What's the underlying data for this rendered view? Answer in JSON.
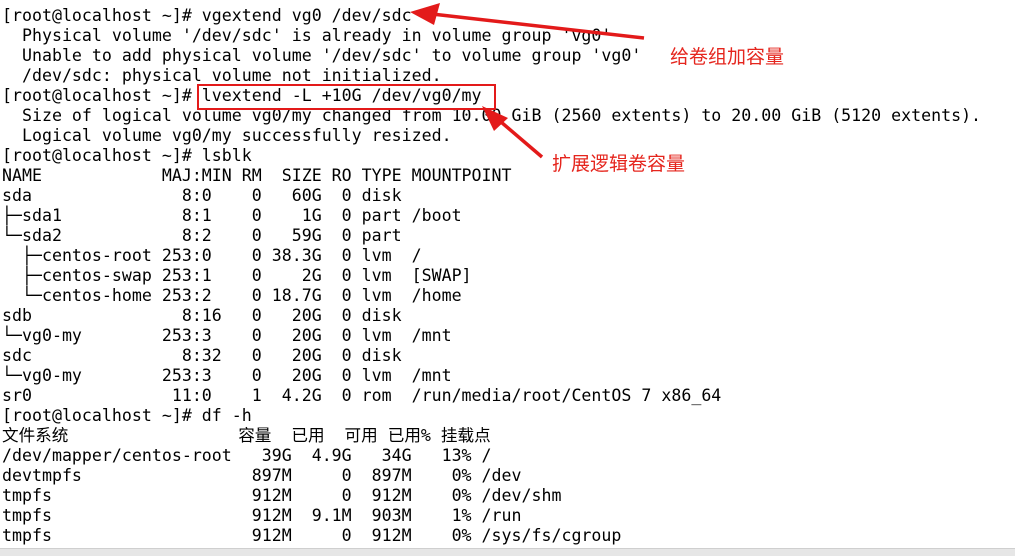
{
  "terminal": {
    "lines": [
      "[root@localhost ~]# vgextend vg0 /dev/sdc",
      "  Physical volume '/dev/sdc' is already in volume group 'vg0'",
      "  Unable to add physical volume '/dev/sdc' to volume group 'vg0'",
      "  /dev/sdc: physical volume not initialized.",
      "[root@localhost ~]# lvextend -L +10G /dev/vg0/my",
      "  Size of logical volume vg0/my changed from 10.00 GiB (2560 extents) to 20.00 GiB (5120 extents).",
      "  Logical volume vg0/my successfully resized.",
      "[root@localhost ~]# lsblk",
      "NAME            MAJ:MIN RM  SIZE RO TYPE MOUNTPOINT",
      "sda               8:0    0   60G  0 disk",
      "├─sda1            8:1    0    1G  0 part /boot",
      "└─sda2            8:2    0   59G  0 part",
      "  ├─centos-root 253:0    0 38.3G  0 lvm  /",
      "  ├─centos-swap 253:1    0    2G  0 lvm  [SWAP]",
      "  └─centos-home 253:2    0 18.7G  0 lvm  /home",
      "sdb               8:16   0   20G  0 disk",
      "└─vg0-my        253:3    0   20G  0 lvm  /mnt",
      "sdc               8:32   0   20G  0 disk",
      "└─vg0-my        253:3    0   20G  0 lvm  /mnt",
      "sr0              11:0    1  4.2G  0 rom  /run/media/root/CentOS 7 x86_64",
      "[root@localhost ~]# df -h",
      "文件系统                 容量  已用  可用 已用% 挂载点",
      "/dev/mapper/centos-root   39G  4.9G   34G   13% /",
      "devtmpfs                 897M     0  897M    0% /dev",
      "tmpfs                    912M     0  912M    0% /dev/shm",
      "tmpfs                    912M  9.1M  903M    1% /run",
      "tmpfs                    912M     0  912M    0% /sys/fs/cgroup"
    ]
  },
  "annotations": {
    "add_vg_label": "给卷组加容量",
    "extend_lv_label": "扩展逻辑卷容量",
    "color": "#e5251d"
  }
}
